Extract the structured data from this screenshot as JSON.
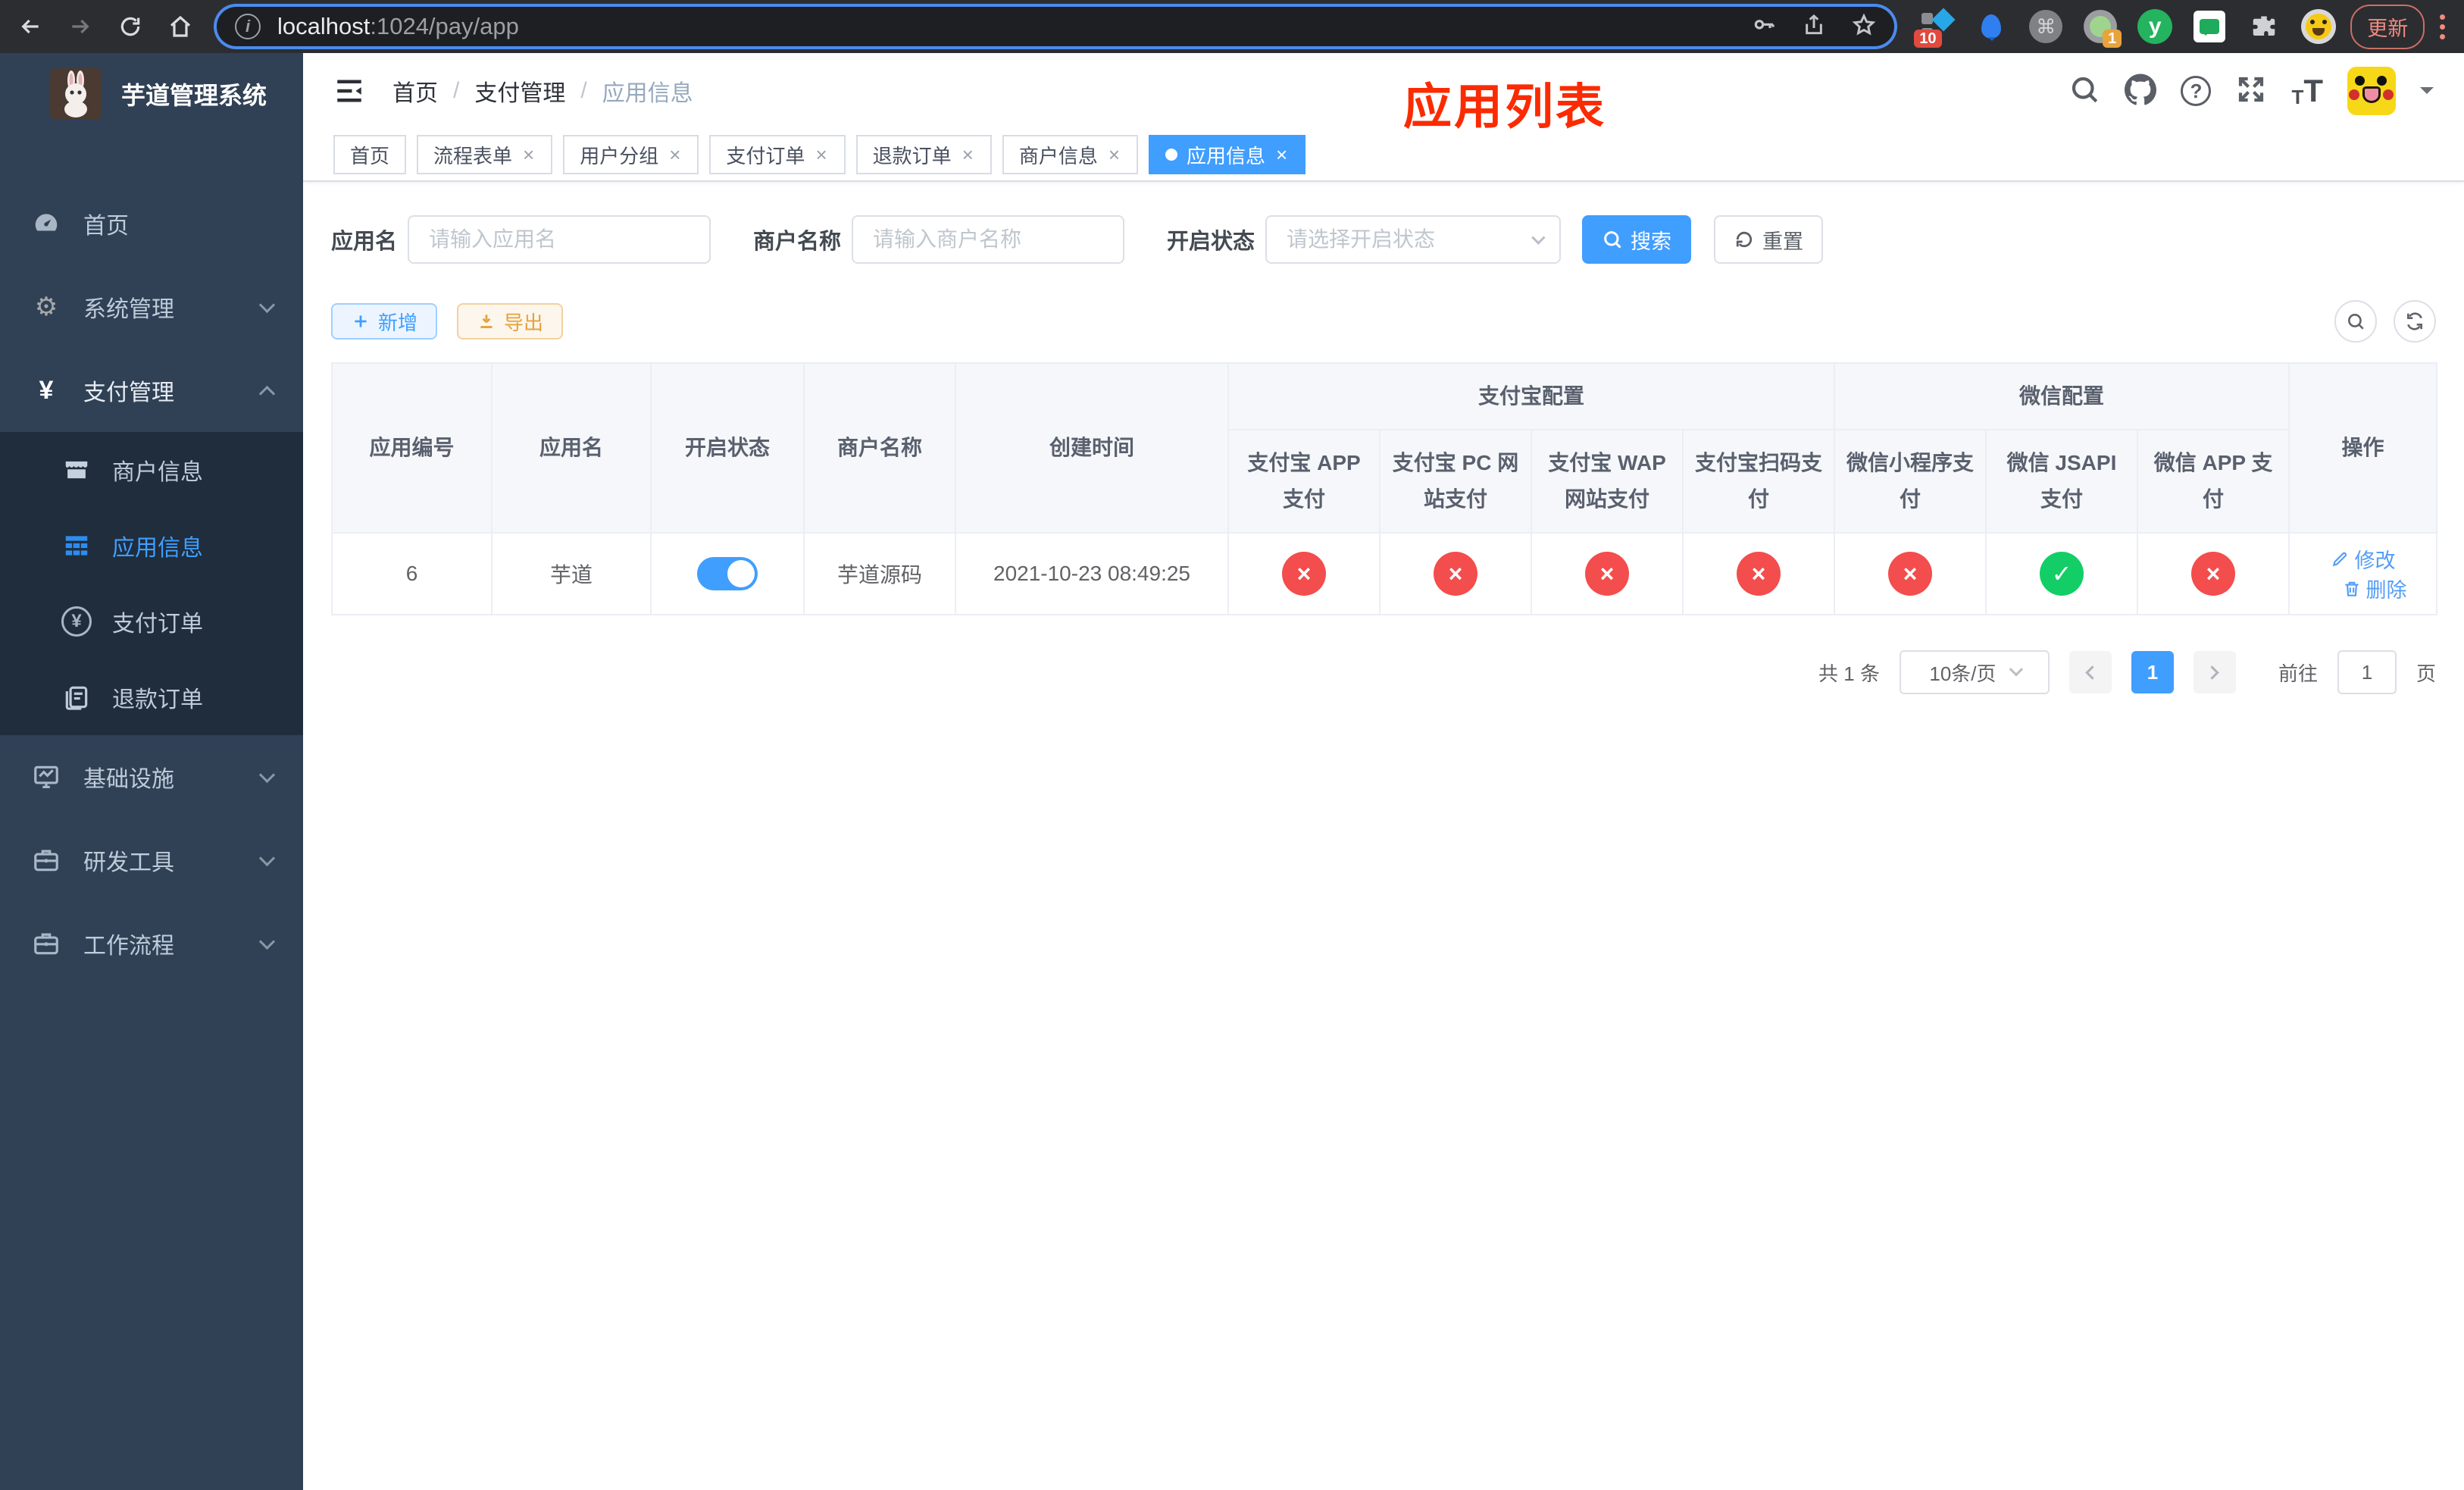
{
  "colors": {
    "primary": "#409eff",
    "danger": "#f34d4d",
    "success": "#13ce66",
    "overlay_red": "#fb2b00",
    "export_orange": "#e6a23c"
  },
  "browser": {
    "url_host": "localhost",
    "url_path": ":1024/pay/app",
    "update_button": "更新",
    "ext_badge_10": "10",
    "ext_badge_1": "1",
    "ext_y_label": "y"
  },
  "sidebar": {
    "title": "芋道管理系统",
    "home": "首页",
    "system": "系统管理",
    "payment": "支付管理",
    "merchant_info": "商户信息",
    "app_info": "应用信息",
    "pay_order": "支付订单",
    "refund_order": "退款订单",
    "infra": "基础设施",
    "dev_tools": "研发工具",
    "workflow": "工作流程"
  },
  "header": {
    "breadcrumb_home": "首页",
    "breadcrumb_payment": "支付管理",
    "breadcrumb_current": "应用信息",
    "overlay_title": "应用列表"
  },
  "tabs": [
    {
      "label": "首页"
    },
    {
      "label": "流程表单"
    },
    {
      "label": "用户分组"
    },
    {
      "label": "支付订单"
    },
    {
      "label": "退款订单"
    },
    {
      "label": "商户信息"
    },
    {
      "label": "应用信息"
    }
  ],
  "search": {
    "app_name_label": "应用名",
    "app_name_placeholder": "请输入应用名",
    "merchant_label": "商户名称",
    "merchant_placeholder": "请输入商户名称",
    "status_label": "开启状态",
    "status_placeholder": "请选择开启状态",
    "search_button": "搜索",
    "reset_button": "重置"
  },
  "toolbar": {
    "add_button": "新增",
    "export_button": "导出"
  },
  "table": {
    "col_app_id": "应用编号",
    "col_app_name": "应用名",
    "col_status": "开启状态",
    "col_merchant": "商户名称",
    "col_created": "创建时间",
    "group_alipay": "支付宝配置",
    "group_wechat": "微信配置",
    "sub_alipay": [
      "支付宝 APP 支付",
      "支付宝 PC 网站支付",
      "支付宝 WAP 网站支付",
      "支付宝扫码支付"
    ],
    "sub_wechat": [
      "微信小程序支付",
      "微信 JSAPI 支付",
      "微信 APP 支付"
    ],
    "col_action": "操作",
    "rows": [
      {
        "id": "6",
        "name": "芋道",
        "enabled": true,
        "merchant": "芋道源码",
        "created": "2021-10-23 08:49:25",
        "alipay_app": false,
        "alipay_pc": false,
        "alipay_wap": false,
        "alipay_qr": false,
        "wechat_lite": false,
        "wechat_jsapi": true,
        "wechat_app": false,
        "edit": "修改",
        "delete": "删除"
      }
    ]
  },
  "pagination": {
    "total": "共 1 条",
    "page_size": "10条/页",
    "page": "1",
    "goto_label": "前往",
    "goto_value": "1",
    "unit": "页"
  }
}
